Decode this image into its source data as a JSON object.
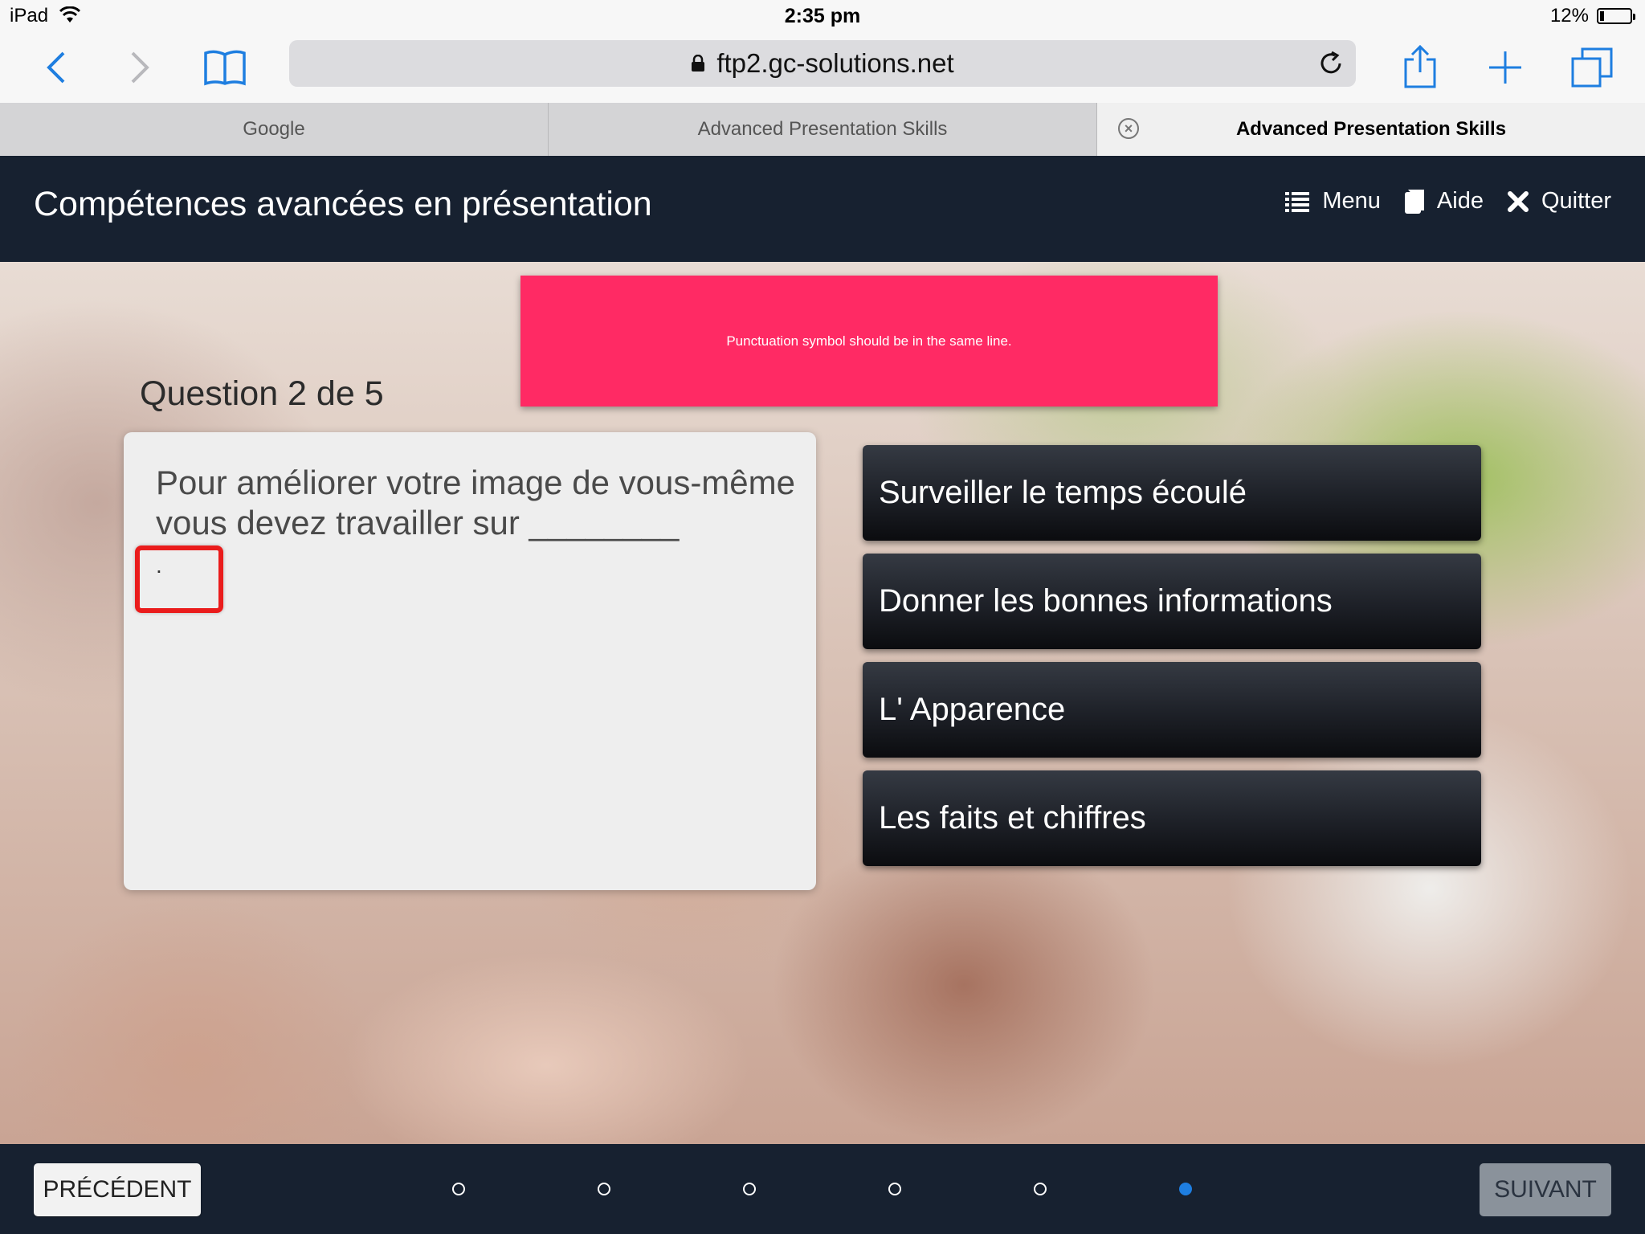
{
  "status_bar": {
    "device": "iPad",
    "time": "2:35 pm",
    "battery": "12%"
  },
  "browser": {
    "url": "ftp2.gc-solutions.net",
    "icons": [
      "back-icon",
      "forward-icon",
      "bookmarks-icon",
      "lock-icon",
      "reload-icon",
      "share-icon",
      "add-tab-icon",
      "tabs-icon"
    ],
    "tabs": [
      {
        "label": "Google"
      },
      {
        "label": "Advanced Presentation Skills"
      },
      {
        "label": "Advanced Presentation Skills"
      }
    ]
  },
  "course": {
    "title": "Compétences avancées en présentation",
    "nav": {
      "menu": "Menu",
      "help": "Aide",
      "quit": "Quitter"
    }
  },
  "feedback": {
    "message": "Punctuation symbol should be in the same line."
  },
  "question": {
    "counter": "Question 2 de 5",
    "text": "Pour améliorer votre image de vous-même vous devez travailler sur ________",
    "trailing_punctuation": "."
  },
  "answers": [
    {
      "label": "Surveiller le temps écoulé"
    },
    {
      "label": "Donner les bonnes informations"
    },
    {
      "label": "L' Apparence"
    },
    {
      "label": "Les faits et chiffres"
    }
  ],
  "footer": {
    "prev_label": "PRÉCÉDENT",
    "next_label": "SUIVANT",
    "progress": {
      "total": 6,
      "current": 6
    }
  },
  "colors": {
    "header_bg": "#172130",
    "feedback_bg": "#ff2a64",
    "highlight_border": "#ea1c1c",
    "ios_blue": "#1e7ee0"
  }
}
